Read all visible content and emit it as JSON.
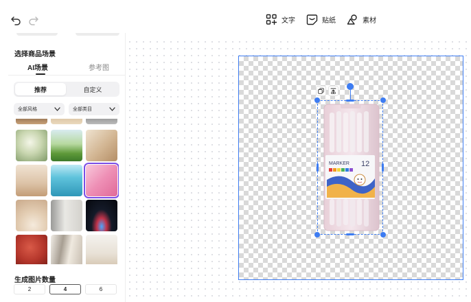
{
  "toolbar": {
    "undo_icon": "undo-icon",
    "redo_icon": "redo-icon",
    "tools": [
      {
        "label": "文字",
        "icon": "text-grid-icon"
      },
      {
        "label": "贴纸",
        "icon": "sticker-icon"
      },
      {
        "label": "素材",
        "icon": "material-icon"
      }
    ]
  },
  "sidebar": {
    "section_title": "选择商品场景",
    "tabs": [
      {
        "label": "AI场景",
        "active": true
      },
      {
        "label": "参考图",
        "active": false
      }
    ],
    "segments": [
      {
        "label": "推荐",
        "active": true
      },
      {
        "label": "自定义",
        "active": false
      }
    ],
    "filters": [
      {
        "label": "全部风格"
      },
      {
        "label": "全部类目"
      }
    ],
    "scenes_selected_index": 5,
    "quantity_title": "生成图片数量",
    "quantities": [
      {
        "label": "2",
        "active": false
      },
      {
        "label": "4",
        "active": true
      },
      {
        "label": "6",
        "active": false
      }
    ]
  },
  "product": {
    "brand_text": "MARKER",
    "count_text": "12"
  },
  "colors": {
    "accent": "#3d7cf2",
    "selected_scene_outline": "#7a4de6"
  }
}
